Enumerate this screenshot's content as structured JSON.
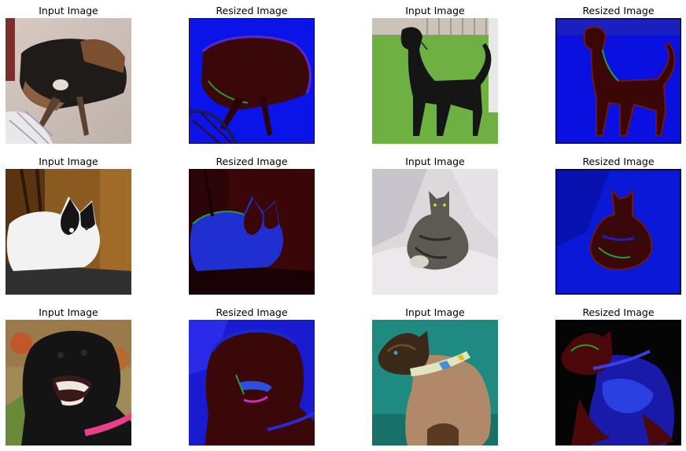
{
  "figure": {
    "panels": [
      {
        "title": "Input Image",
        "image": "photo of a black and tan dog lying asleep on a carpet",
        "kind": "input"
      },
      {
        "title": "Resized Image",
        "image": "blue and dark red filtered version of the sleeping dog",
        "kind": "resized"
      },
      {
        "title": "Input Image",
        "image": "photo of a black dog standing on green grass",
        "kind": "input"
      },
      {
        "title": "Resized Image",
        "image": "blue and dark red filtered version of the standing dog",
        "kind": "resized"
      },
      {
        "title": "Input Image",
        "image": "photo of a black and white cat sitting on a chair",
        "kind": "input"
      },
      {
        "title": "Resized Image",
        "image": "dark red and blue filtered version of the black and white cat",
        "kind": "resized"
      },
      {
        "title": "Input Image",
        "image": "photo of a tabby cat curled on a white blanket",
        "kind": "input"
      },
      {
        "title": "Resized Image",
        "image": "blue and dark red filtered version of the tabby cat",
        "kind": "resized"
      },
      {
        "title": "Input Image",
        "image": "photo of a black dog with mouth open wearing a pink collar",
        "kind": "input"
      },
      {
        "title": "Resized Image",
        "image": "dark red and blue filtered version of the barking black dog",
        "kind": "resized"
      },
      {
        "title": "Input Image",
        "image": "photo of a siamese cat on a teal background wearing a collar",
        "kind": "input"
      },
      {
        "title": "Resized Image",
        "image": "black, dark red and blue filtered version of the siamese cat",
        "kind": "resized"
      }
    ]
  }
}
